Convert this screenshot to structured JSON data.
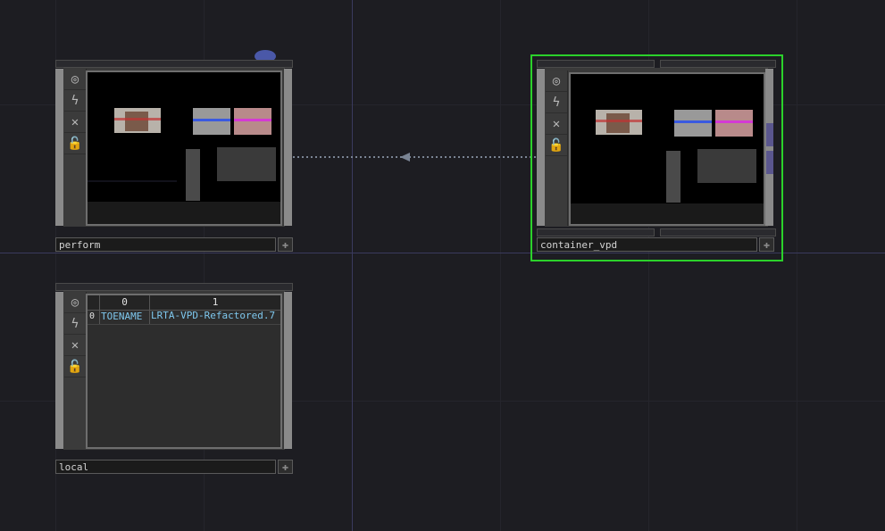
{
  "network": {
    "grid": {
      "color": "#25252c",
      "axis_color": "#3a3a5e"
    },
    "link_color": "#7a8494",
    "selected_color": "#2bd12b"
  },
  "nodes": [
    {
      "id": "perform",
      "name": "perform",
      "type": "viewer-top"
    },
    {
      "id": "container_vpd",
      "name": "container_vpd",
      "type": "viewer-top",
      "selected": true
    },
    {
      "id": "local",
      "name": "local",
      "type": "table-dat",
      "table": {
        "columns": [
          "0",
          "1"
        ],
        "rows": [
          {
            "index": "0",
            "cells": [
              "TOENAME",
              "LRTA-VPD-Refactored.7"
            ]
          }
        ]
      }
    }
  ],
  "flags": [
    "viewer-flag-icon",
    "bypass-flag-icon",
    "cook-flag-icon",
    "lock-flag-icon"
  ],
  "comment_icon": "speech-bubble-icon"
}
